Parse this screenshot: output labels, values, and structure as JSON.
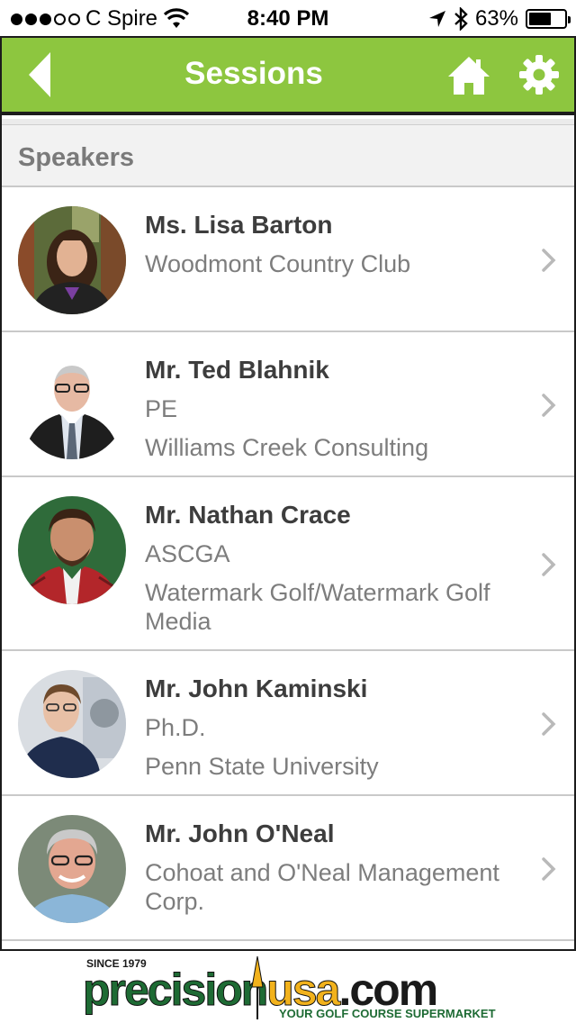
{
  "status_bar": {
    "carrier": "C Spire",
    "time": "8:40 PM",
    "battery": "63%",
    "battery_level": 0.63,
    "signal_bars": 3,
    "signal_total": 5
  },
  "navbar": {
    "title": "Sessions",
    "back_icon": "back-arrow-icon",
    "home_icon": "home-icon",
    "settings_icon": "gear-icon",
    "color": "#8dc63f"
  },
  "section": {
    "title": "Speakers"
  },
  "speakers": [
    {
      "name": "Ms. Lisa Barton",
      "lines": [
        "Woodmont Country Club"
      ]
    },
    {
      "name": "Mr. Ted Blahnik",
      "lines": [
        "PE",
        "Williams Creek Consulting"
      ]
    },
    {
      "name": "Mr. Nathan Crace",
      "lines": [
        "ASCGA",
        "Watermark Golf/Watermark Golf",
        "Media"
      ]
    },
    {
      "name": "Mr. John Kaminski",
      "lines": [
        "Ph.D.",
        "Penn State University"
      ]
    },
    {
      "name": "Mr. John O'Neal",
      "lines": [
        "Cohoat and O'Neal Management",
        "Corp."
      ]
    }
  ],
  "footer": {
    "since": "SINCE 1979",
    "brand_precision": "precision",
    "brand_usa": "usa",
    "brand_com": ".com",
    "tagline": "YOUR GOLF COURSE SUPERMARKET"
  }
}
